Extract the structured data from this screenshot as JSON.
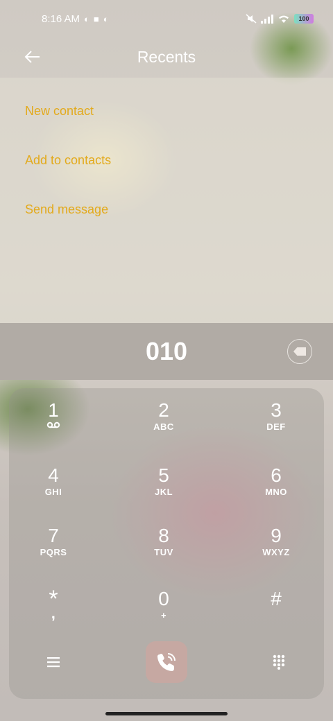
{
  "status_bar": {
    "time": "8:16 AM",
    "battery": "100",
    "icons": [
      "data-saver-icon",
      "square-icon",
      "data-saver-icon",
      "mute-icon",
      "signal-icon",
      "wifi-icon",
      "battery-icon"
    ]
  },
  "header": {
    "title": "Recents",
    "back_icon": "arrow-left-icon"
  },
  "menu": {
    "items": [
      {
        "label": "New contact"
      },
      {
        "label": "Add to contacts"
      },
      {
        "label": "Send message"
      }
    ],
    "accent_color": "#e3aa1c"
  },
  "display": {
    "digits": "010",
    "backspace_icon": "backspace-icon"
  },
  "keypad": {
    "keys": [
      {
        "digit": "1",
        "letters": "voicemail"
      },
      {
        "digit": "2",
        "letters": "ABC"
      },
      {
        "digit": "3",
        "letters": "DEF"
      },
      {
        "digit": "4",
        "letters": "GHI"
      },
      {
        "digit": "5",
        "letters": "JKL"
      },
      {
        "digit": "6",
        "letters": "MNO"
      },
      {
        "digit": "7",
        "letters": "PQRS"
      },
      {
        "digit": "8",
        "letters": "TUV"
      },
      {
        "digit": "9",
        "letters": "WXYZ"
      },
      {
        "digit": "*",
        "letters": ","
      },
      {
        "digit": "0",
        "letters": "+"
      },
      {
        "digit": "#",
        "letters": ""
      }
    ],
    "menu_icon": "menu-icon",
    "call_icon": "phone-call-icon",
    "dialpad_icon": "dialpad-icon",
    "call_color": "#c6a8a2"
  }
}
